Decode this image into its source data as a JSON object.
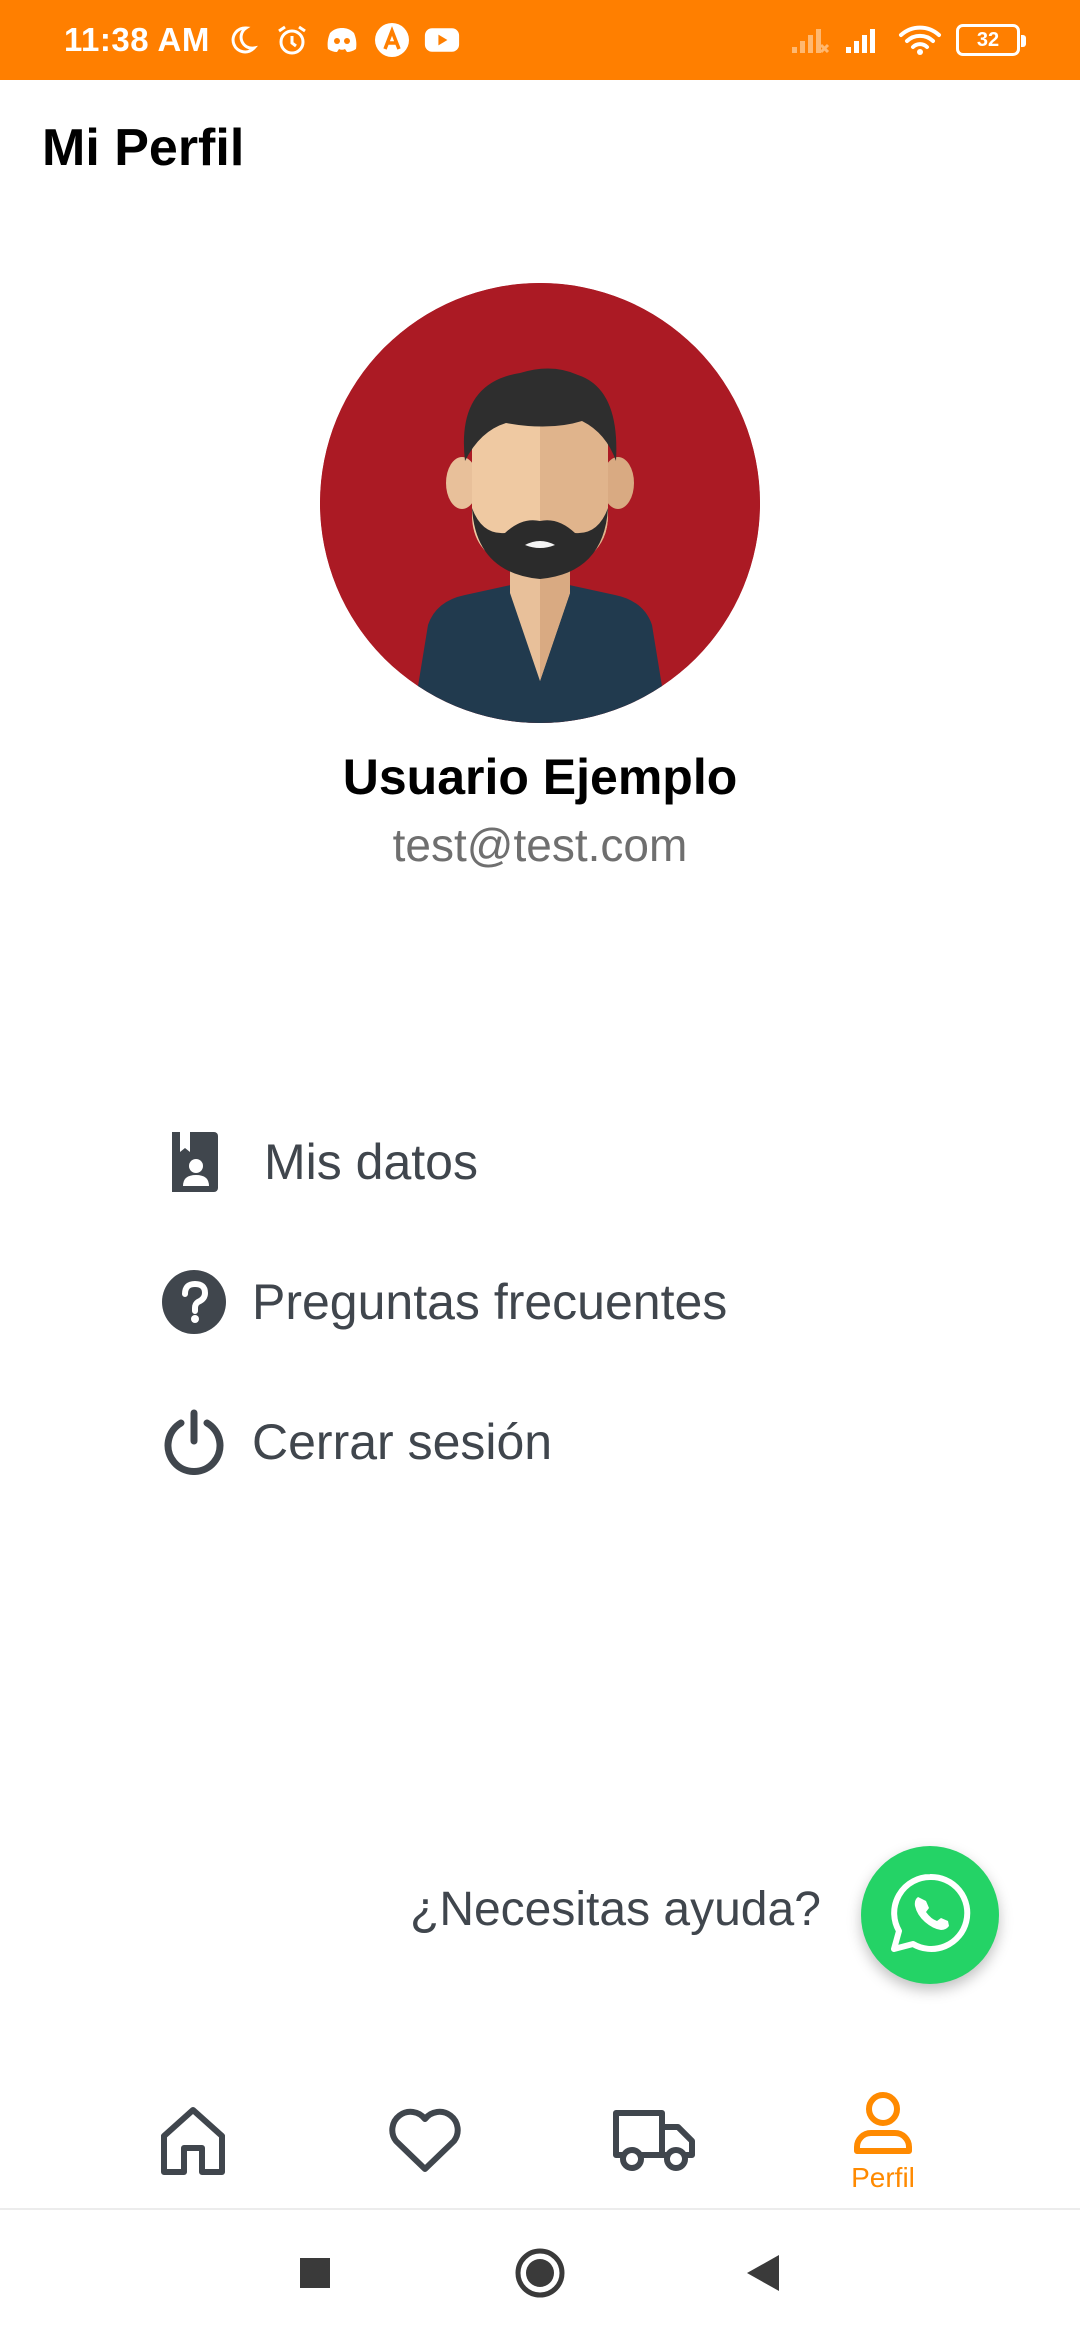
{
  "status_bar": {
    "time": "11:38 AM",
    "battery": "32",
    "icons": [
      "moon-icon",
      "alarm-icon",
      "discord-icon",
      "app-a-icon",
      "youtube-icon",
      "signal-icon",
      "signal-icon",
      "wifi-icon",
      "battery-icon"
    ],
    "background_color": "#ff7f00"
  },
  "header": {
    "title": "Mi Perfil"
  },
  "profile": {
    "name": "Usuario Ejemplo",
    "email": "test@test.com",
    "avatar_background": "#ab1a24"
  },
  "menu": {
    "items": [
      {
        "label": "Mis datos",
        "icon": "contact-book-icon"
      },
      {
        "label": "Preguntas frecuentes",
        "icon": "question-circle-icon"
      },
      {
        "label": "Cerrar sesión",
        "icon": "power-icon"
      }
    ]
  },
  "help": {
    "text": "¿Necesitas ayuda?",
    "icon": "whatsapp-icon",
    "color": "#24d366"
  },
  "bottom_nav": {
    "items": [
      {
        "icon": "home-icon",
        "label": ""
      },
      {
        "icon": "heart-icon",
        "label": ""
      },
      {
        "icon": "truck-icon",
        "label": ""
      },
      {
        "icon": "user-icon",
        "label": "Perfil",
        "active": true
      }
    ],
    "active_color": "#ff8a00",
    "inactive_color": "#40464d"
  },
  "system_nav": {
    "icons": [
      "recents-square-icon",
      "home-circle-icon",
      "back-triangle-icon"
    ]
  }
}
